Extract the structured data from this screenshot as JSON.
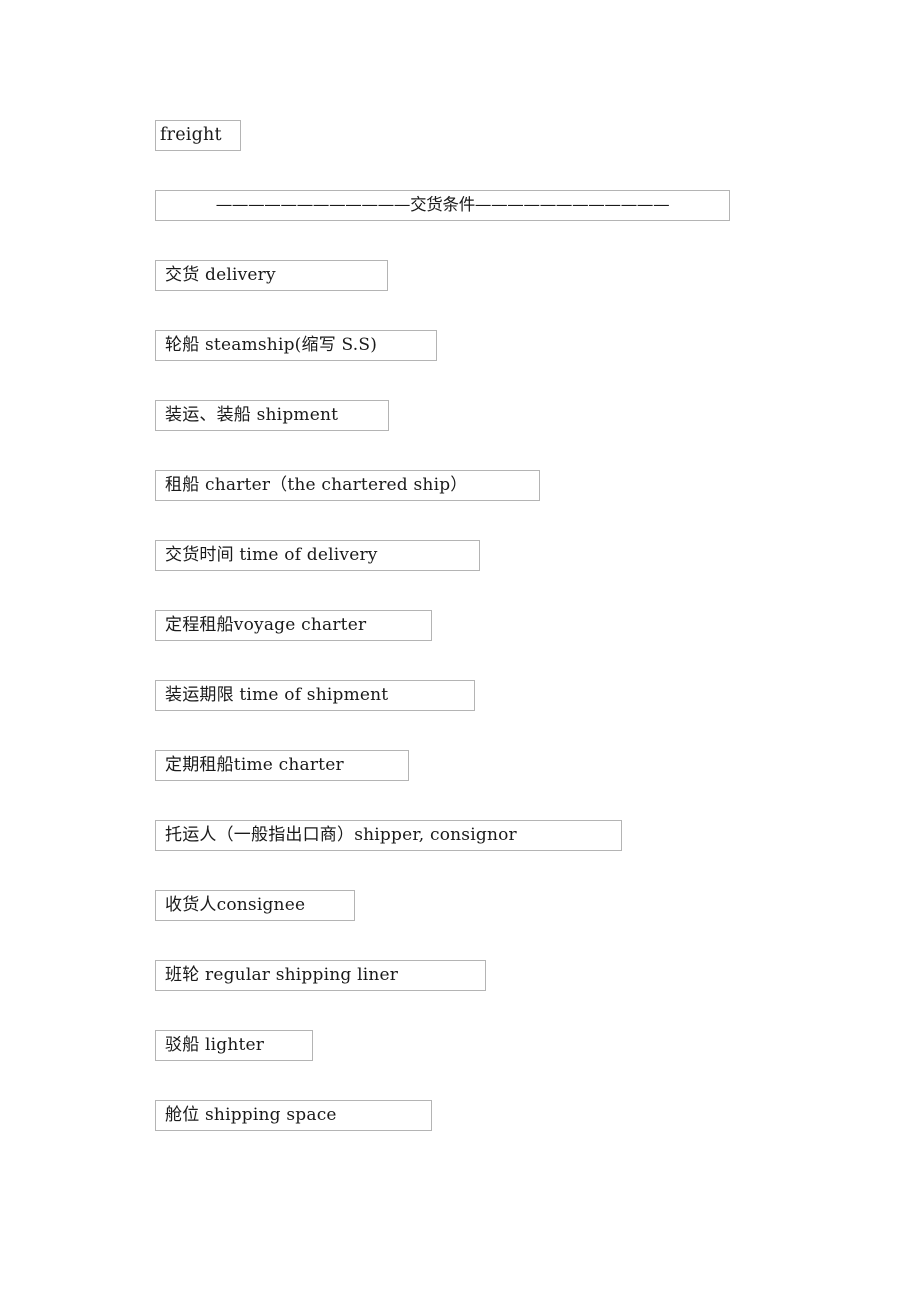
{
  "document": {
    "background_color": "#ffffff",
    "text_color": "#1a1a1a",
    "border_color": "#b4b4b4"
  },
  "first_entry": {
    "text": "freight"
  },
  "separator": {
    "text": "————————————交货条件————————————",
    "heading": "交货条件"
  },
  "entries": [
    {
      "text": "交货 delivery"
    },
    {
      "text": "轮船 steamship(缩写 S.S)"
    },
    {
      "text": "装运、装船 shipment"
    },
    {
      "text": "租船 charter（the chartered ship）"
    },
    {
      "text": "交货时间 time of delivery"
    },
    {
      "text": "定程租船voyage charter"
    },
    {
      "text": "装运期限 time of shipment"
    },
    {
      "text": "定期租船time charter"
    },
    {
      "text": "托运人（一般指出口商）shipper, consignor"
    },
    {
      "text": "收货人consignee"
    },
    {
      "text": "班轮 regular shipping liner"
    },
    {
      "text": "驳船 lighter"
    },
    {
      "text": "舱位 shipping space"
    }
  ]
}
